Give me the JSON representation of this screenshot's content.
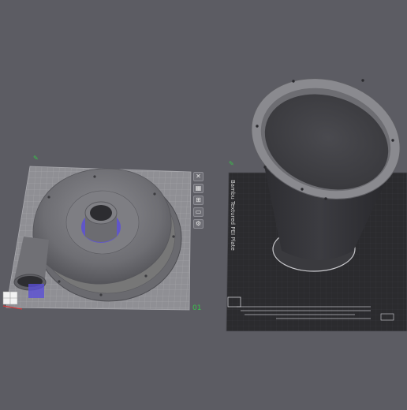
{
  "plates": [
    {
      "number": "01",
      "tools": [
        "close",
        "arrange",
        "orient",
        "lock",
        "settings"
      ]
    },
    {
      "label": "Bambu Textured PEI Plate"
    }
  ],
  "icons": [
    "edit-icon",
    "close-icon",
    "arrange-icon",
    "orient-icon",
    "lock-icon",
    "settings-icon",
    "axis-gizmo"
  ],
  "colors": {
    "background": "#5c5c63",
    "plate_1": "#8f8f94",
    "plate_2": "#2b2b2e",
    "model": "#7b7b80",
    "accent_blue": "#5a4fd6",
    "plate_number": "#39c24a"
  }
}
